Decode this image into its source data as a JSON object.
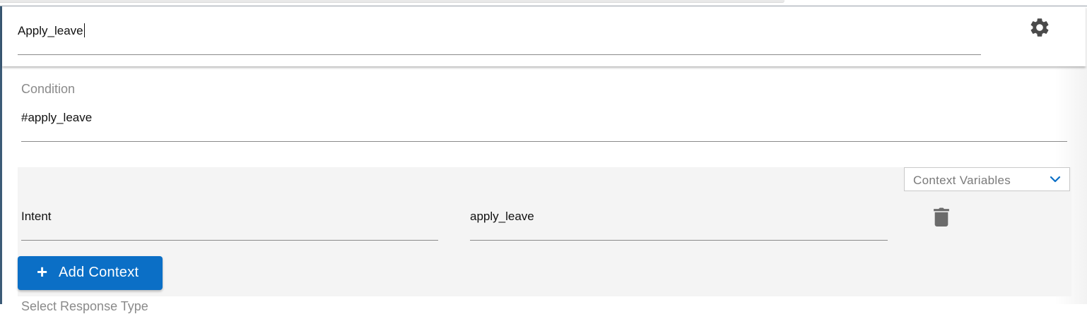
{
  "header": {
    "node_name": "Apply_leave",
    "settings_icon": "gear-icon"
  },
  "condition": {
    "label": "Condition",
    "value": "#apply_leave"
  },
  "context": {
    "dropdown_label": "Context Variables",
    "dropdown_icon": "chevron-down-icon",
    "rows": [
      {
        "key": "Intent",
        "value": "apply_leave",
        "delete_icon": "trash-icon"
      }
    ],
    "add_button": {
      "icon": "plus-icon",
      "label": "Add Context"
    }
  },
  "next_section": {
    "label": "Select Response Type"
  },
  "colors": {
    "primary_button": "#0b6fc6",
    "chevron": "#0b6fc6",
    "icon_gray": "#6b6b6b",
    "panel_bg": "#f4f4f4"
  }
}
